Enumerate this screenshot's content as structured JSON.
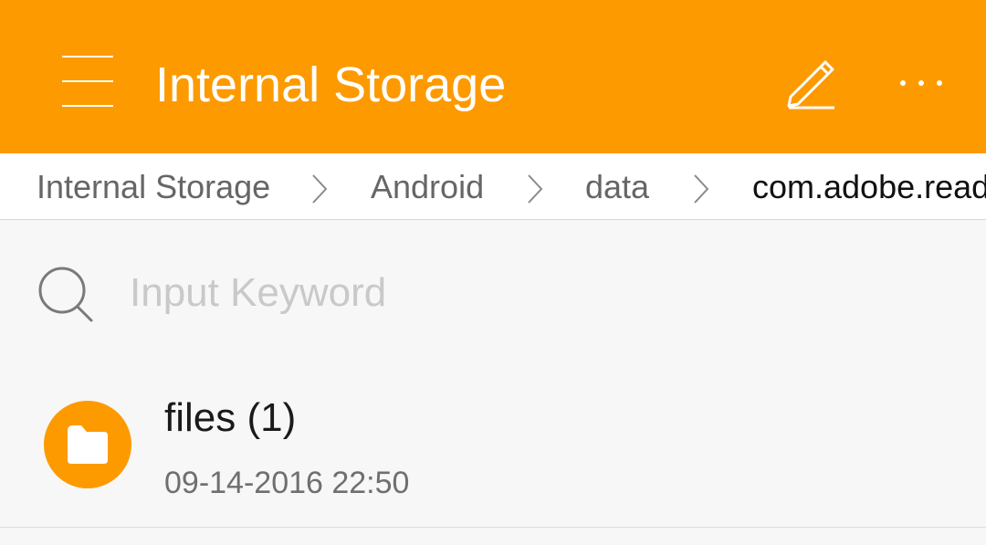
{
  "app_bar": {
    "title": "Internal Storage",
    "background_color": "#fd9a00",
    "menu_icon": "menu-icon",
    "edit_icon": "pencil-icon",
    "more_icon": "more-icon"
  },
  "breadcrumb": {
    "items": [
      {
        "label": "Internal Storage"
      },
      {
        "label": "Android"
      },
      {
        "label": "data"
      },
      {
        "label": "com.adobe.reader"
      }
    ],
    "separator_icon": "chevron-right-icon"
  },
  "search": {
    "placeholder": "Input Keyword",
    "value": "",
    "icon": "search-icon"
  },
  "files": [
    {
      "name": "files (1)",
      "date": "09-14-2016 22:50",
      "icon": "folder-icon",
      "icon_color": "#fd9a00"
    }
  ]
}
